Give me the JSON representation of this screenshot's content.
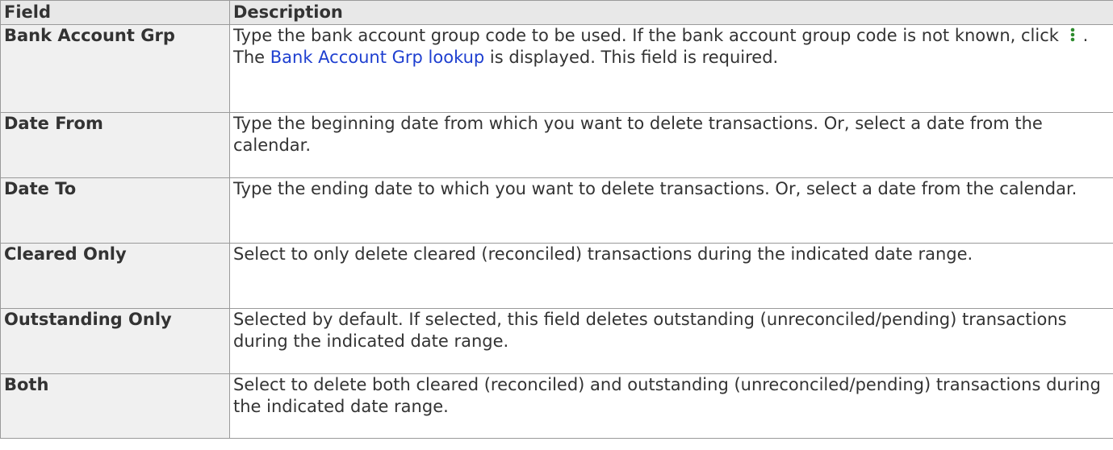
{
  "table": {
    "headers": {
      "field": "Field",
      "description": "Description"
    },
    "rows": [
      {
        "field": "Bank Account Grp",
        "desc_before": "Type the bank account group code to be used. If the bank account group code is not known, click",
        "icon": "vertical-ellipsis-lookup-icon",
        "desc_middle": ". The",
        "link": "Bank Account Grp lookup",
        "desc_after": "is displayed. This field is required."
      },
      {
        "field": "Date From",
        "desc": "Type the beginning date from which you want to delete transactions. Or, select a date from the calendar."
      },
      {
        "field": "Date To",
        "desc": "Type the ending date to which you want to delete transactions. Or, select a date from the calendar."
      },
      {
        "field": "Cleared Only",
        "desc": "Select to only delete cleared (reconciled) transactions during the indicated date range."
      },
      {
        "field": "Outstanding Only",
        "desc": "Selected by default. If selected, this field deletes outstanding (unreconciled/pending) transactions during the indicated date range."
      },
      {
        "field": "Both",
        "desc": "Select to delete both cleared (reconciled) and outstanding (unreconciled/pending) transactions during the indicated date range."
      }
    ]
  },
  "colors": {
    "header_bg": "#e8e8e8",
    "field_bg": "#f0f0f0",
    "text": "#333333",
    "link": "#1e3fd0",
    "icon": "#2e8b2e",
    "border": "#9a9a9a"
  }
}
